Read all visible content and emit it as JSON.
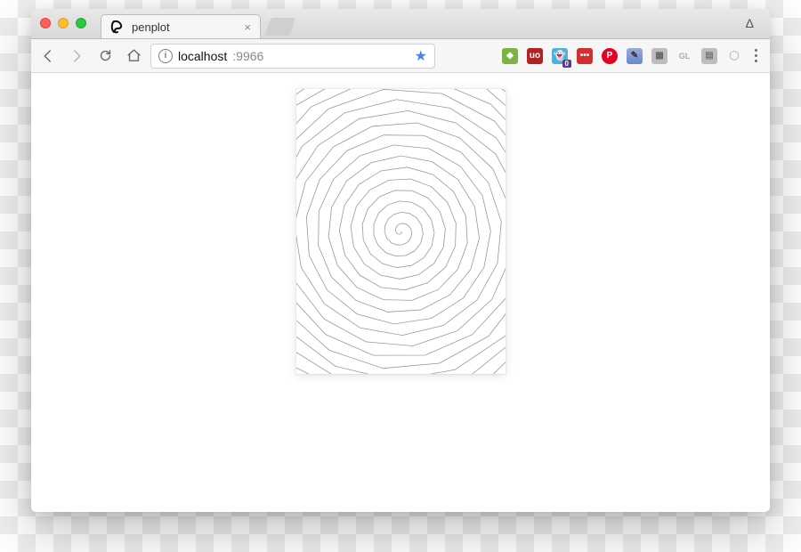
{
  "window": {
    "tab": {
      "title": "penplot",
      "close_glyph": "×"
    },
    "delta_glyph": "Δ"
  },
  "toolbar": {
    "url_host": "localhost",
    "url_port": ":9966",
    "info_glyph": "i",
    "star_glyph": "★"
  },
  "extensions": {
    "android": "◆",
    "ublock": "uo",
    "ghostery": "👻",
    "badge0": "0",
    "lastpass": "•••",
    "pinterest": "P",
    "eyedropper": "✎",
    "grid": "▦",
    "gl": "GL",
    "notes": "▤",
    "circle": "◯"
  }
}
